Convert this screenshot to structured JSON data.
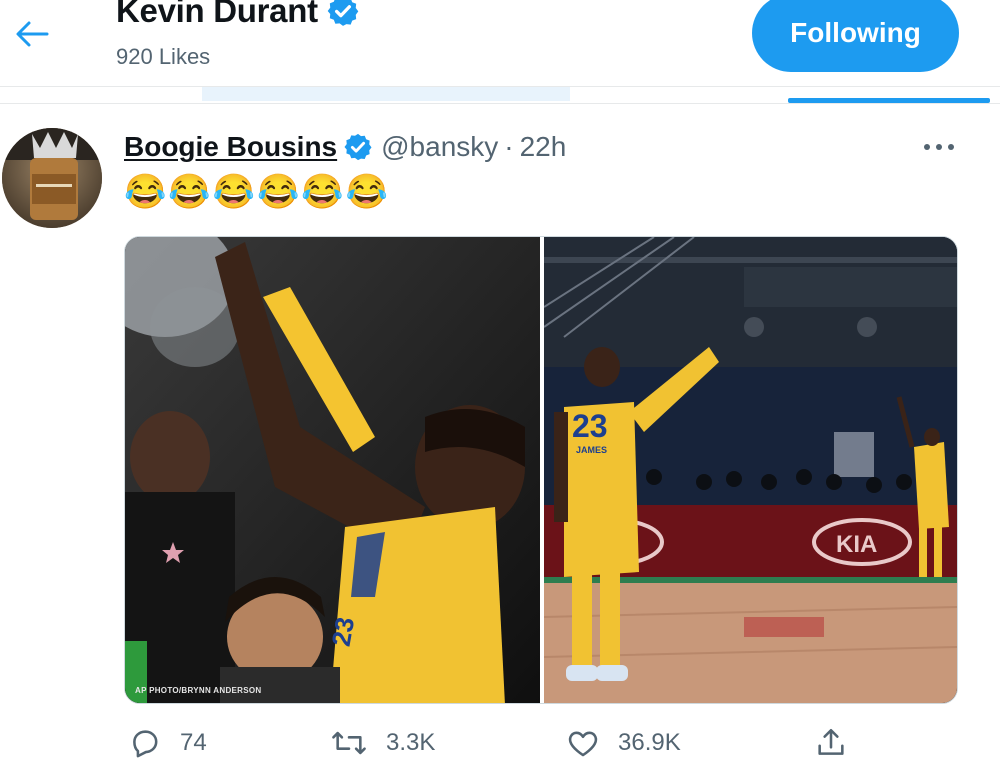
{
  "header": {
    "name": "Kevin Durant",
    "subtitle": "920 Likes",
    "follow_label": "Following",
    "back_icon": "arrow-left-icon",
    "verified_icon": "verified-badge-icon"
  },
  "tweet": {
    "author_name": "Boogie Bousins",
    "handle": "@bansky",
    "separator": "·",
    "time": "22h",
    "text": "😂😂😂😂😂😂",
    "more_icon": "more-horizontal-icon",
    "media": {
      "left_credit": "AP PHOTO/BRYNN ANDERSON",
      "left_jersey_number": "23",
      "right_jersey_number": "23",
      "right_jersey_name": "JAMES",
      "court_sponsor": "KIA"
    },
    "actions": {
      "reply_count": "74",
      "retweet_count": "3.3K",
      "like_count": "36.9K"
    }
  },
  "colors": {
    "accent": "#1d9bf0",
    "text_secondary": "#536471",
    "divider": "#e7e9ea"
  }
}
